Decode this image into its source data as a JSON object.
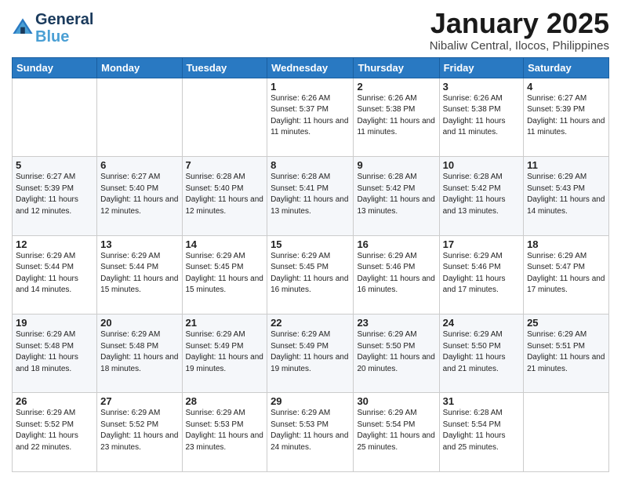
{
  "header": {
    "logo_line1": "General",
    "logo_line2": "Blue",
    "month": "January 2025",
    "location": "Nibaliw Central, Ilocos, Philippines"
  },
  "days_of_week": [
    "Sunday",
    "Monday",
    "Tuesday",
    "Wednesday",
    "Thursday",
    "Friday",
    "Saturday"
  ],
  "weeks": [
    [
      {
        "day": "",
        "sunrise": "",
        "sunset": "",
        "daylight": ""
      },
      {
        "day": "",
        "sunrise": "",
        "sunset": "",
        "daylight": ""
      },
      {
        "day": "",
        "sunrise": "",
        "sunset": "",
        "daylight": ""
      },
      {
        "day": "1",
        "sunrise": "Sunrise: 6:26 AM",
        "sunset": "Sunset: 5:37 PM",
        "daylight": "Daylight: 11 hours and 11 minutes."
      },
      {
        "day": "2",
        "sunrise": "Sunrise: 6:26 AM",
        "sunset": "Sunset: 5:38 PM",
        "daylight": "Daylight: 11 hours and 11 minutes."
      },
      {
        "day": "3",
        "sunrise": "Sunrise: 6:26 AM",
        "sunset": "Sunset: 5:38 PM",
        "daylight": "Daylight: 11 hours and 11 minutes."
      },
      {
        "day": "4",
        "sunrise": "Sunrise: 6:27 AM",
        "sunset": "Sunset: 5:39 PM",
        "daylight": "Daylight: 11 hours and 11 minutes."
      }
    ],
    [
      {
        "day": "5",
        "sunrise": "Sunrise: 6:27 AM",
        "sunset": "Sunset: 5:39 PM",
        "daylight": "Daylight: 11 hours and 12 minutes."
      },
      {
        "day": "6",
        "sunrise": "Sunrise: 6:27 AM",
        "sunset": "Sunset: 5:40 PM",
        "daylight": "Daylight: 11 hours and 12 minutes."
      },
      {
        "day": "7",
        "sunrise": "Sunrise: 6:28 AM",
        "sunset": "Sunset: 5:40 PM",
        "daylight": "Daylight: 11 hours and 12 minutes."
      },
      {
        "day": "8",
        "sunrise": "Sunrise: 6:28 AM",
        "sunset": "Sunset: 5:41 PM",
        "daylight": "Daylight: 11 hours and 13 minutes."
      },
      {
        "day": "9",
        "sunrise": "Sunrise: 6:28 AM",
        "sunset": "Sunset: 5:42 PM",
        "daylight": "Daylight: 11 hours and 13 minutes."
      },
      {
        "day": "10",
        "sunrise": "Sunrise: 6:28 AM",
        "sunset": "Sunset: 5:42 PM",
        "daylight": "Daylight: 11 hours and 13 minutes."
      },
      {
        "day": "11",
        "sunrise": "Sunrise: 6:29 AM",
        "sunset": "Sunset: 5:43 PM",
        "daylight": "Daylight: 11 hours and 14 minutes."
      }
    ],
    [
      {
        "day": "12",
        "sunrise": "Sunrise: 6:29 AM",
        "sunset": "Sunset: 5:44 PM",
        "daylight": "Daylight: 11 hours and 14 minutes."
      },
      {
        "day": "13",
        "sunrise": "Sunrise: 6:29 AM",
        "sunset": "Sunset: 5:44 PM",
        "daylight": "Daylight: 11 hours and 15 minutes."
      },
      {
        "day": "14",
        "sunrise": "Sunrise: 6:29 AM",
        "sunset": "Sunset: 5:45 PM",
        "daylight": "Daylight: 11 hours and 15 minutes."
      },
      {
        "day": "15",
        "sunrise": "Sunrise: 6:29 AM",
        "sunset": "Sunset: 5:45 PM",
        "daylight": "Daylight: 11 hours and 16 minutes."
      },
      {
        "day": "16",
        "sunrise": "Sunrise: 6:29 AM",
        "sunset": "Sunset: 5:46 PM",
        "daylight": "Daylight: 11 hours and 16 minutes."
      },
      {
        "day": "17",
        "sunrise": "Sunrise: 6:29 AM",
        "sunset": "Sunset: 5:46 PM",
        "daylight": "Daylight: 11 hours and 17 minutes."
      },
      {
        "day": "18",
        "sunrise": "Sunrise: 6:29 AM",
        "sunset": "Sunset: 5:47 PM",
        "daylight": "Daylight: 11 hours and 17 minutes."
      }
    ],
    [
      {
        "day": "19",
        "sunrise": "Sunrise: 6:29 AM",
        "sunset": "Sunset: 5:48 PM",
        "daylight": "Daylight: 11 hours and 18 minutes."
      },
      {
        "day": "20",
        "sunrise": "Sunrise: 6:29 AM",
        "sunset": "Sunset: 5:48 PM",
        "daylight": "Daylight: 11 hours and 18 minutes."
      },
      {
        "day": "21",
        "sunrise": "Sunrise: 6:29 AM",
        "sunset": "Sunset: 5:49 PM",
        "daylight": "Daylight: 11 hours and 19 minutes."
      },
      {
        "day": "22",
        "sunrise": "Sunrise: 6:29 AM",
        "sunset": "Sunset: 5:49 PM",
        "daylight": "Daylight: 11 hours and 19 minutes."
      },
      {
        "day": "23",
        "sunrise": "Sunrise: 6:29 AM",
        "sunset": "Sunset: 5:50 PM",
        "daylight": "Daylight: 11 hours and 20 minutes."
      },
      {
        "day": "24",
        "sunrise": "Sunrise: 6:29 AM",
        "sunset": "Sunset: 5:50 PM",
        "daylight": "Daylight: 11 hours and 21 minutes."
      },
      {
        "day": "25",
        "sunrise": "Sunrise: 6:29 AM",
        "sunset": "Sunset: 5:51 PM",
        "daylight": "Daylight: 11 hours and 21 minutes."
      }
    ],
    [
      {
        "day": "26",
        "sunrise": "Sunrise: 6:29 AM",
        "sunset": "Sunset: 5:52 PM",
        "daylight": "Daylight: 11 hours and 22 minutes."
      },
      {
        "day": "27",
        "sunrise": "Sunrise: 6:29 AM",
        "sunset": "Sunset: 5:52 PM",
        "daylight": "Daylight: 11 hours and 23 minutes."
      },
      {
        "day": "28",
        "sunrise": "Sunrise: 6:29 AM",
        "sunset": "Sunset: 5:53 PM",
        "daylight": "Daylight: 11 hours and 23 minutes."
      },
      {
        "day": "29",
        "sunrise": "Sunrise: 6:29 AM",
        "sunset": "Sunset: 5:53 PM",
        "daylight": "Daylight: 11 hours and 24 minutes."
      },
      {
        "day": "30",
        "sunrise": "Sunrise: 6:29 AM",
        "sunset": "Sunset: 5:54 PM",
        "daylight": "Daylight: 11 hours and 25 minutes."
      },
      {
        "day": "31",
        "sunrise": "Sunrise: 6:28 AM",
        "sunset": "Sunset: 5:54 PM",
        "daylight": "Daylight: 11 hours and 25 minutes."
      },
      {
        "day": "",
        "sunrise": "",
        "sunset": "",
        "daylight": ""
      }
    ]
  ]
}
